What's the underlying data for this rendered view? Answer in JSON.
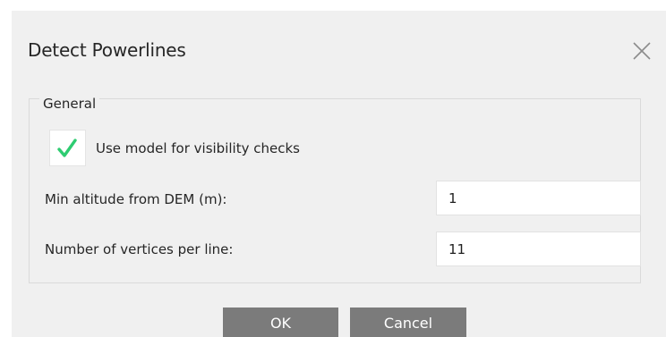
{
  "dialog": {
    "title": "Detect Powerlines",
    "close_icon": "close-icon"
  },
  "group": {
    "legend": "General",
    "visibility_checkbox": {
      "label": "Use model for visibility checks",
      "checked": true,
      "check_icon": "checkmark-icon",
      "check_color": "#2ecc71"
    },
    "fields": [
      {
        "label": "Min altitude from DEM (m):",
        "value": "1"
      },
      {
        "label": "Number of vertices per line:",
        "value": "11"
      }
    ]
  },
  "buttons": {
    "ok_label": "OK",
    "cancel_label": "Cancel"
  },
  "colors": {
    "dialog_background": "#f0f0f0",
    "button_background": "#7b7b7b",
    "button_text": "#ffffff"
  }
}
